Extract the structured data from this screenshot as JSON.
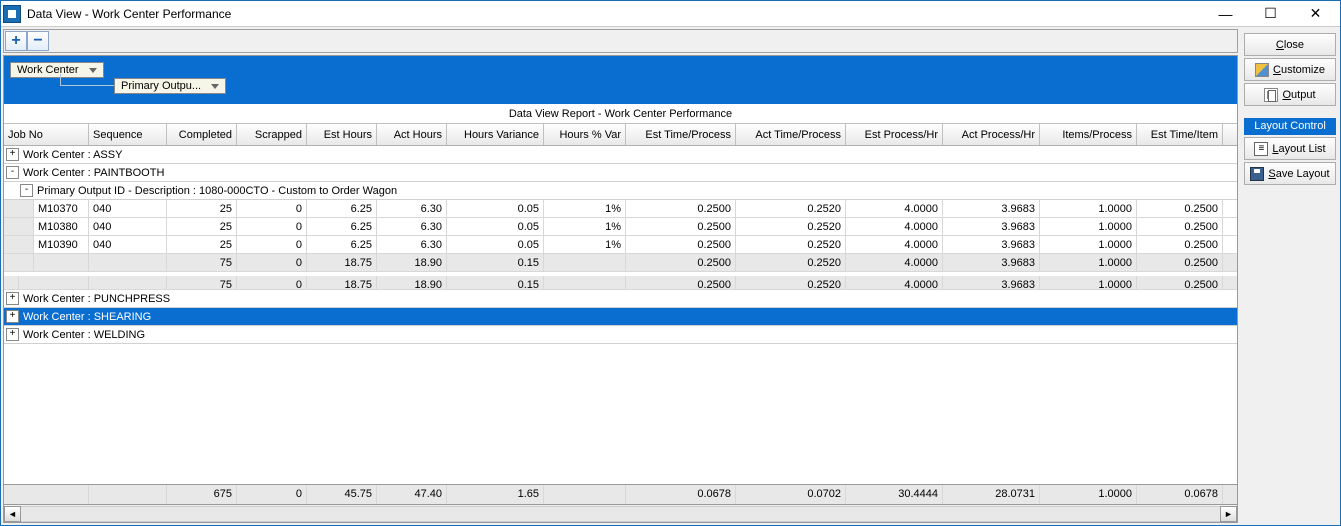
{
  "window": {
    "title": "Data View - Work Center Performance"
  },
  "toolbar": {
    "expand": "+",
    "collapse": "−"
  },
  "group_chips": {
    "g1": "Work Center",
    "g2": "Primary Outpu..."
  },
  "report_title": "Data View Report - Work Center Performance",
  "columns": {
    "job": "Job No",
    "seq": "Sequence",
    "comp": "Completed",
    "scrap": "Scrapped",
    "esth": "Est Hours",
    "acth": "Act Hours",
    "hvar": "Hours Variance",
    "hpvar": "Hours % Var",
    "etp": "Est Time/Process",
    "atp": "Act Time/Process",
    "eph": "Est Process/Hr",
    "aph": "Act Process/Hr",
    "ipp": "Items/Process",
    "eti": "Est Time/Item"
  },
  "groups": {
    "assy": "Work Center : ASSY",
    "paint": "Work Center : PAINTBOOTH",
    "paint_sub": "Primary Output ID - Description : 1080-000CTO - Custom to Order Wagon",
    "punch": "Work Center : PUNCHPRESS",
    "shear": "Work Center : SHEARING",
    "weld": "Work Center : WELDING"
  },
  "rows": [
    {
      "job": "M10370",
      "seq": "040",
      "comp": "25",
      "scrap": "0",
      "esth": "6.25",
      "acth": "6.30",
      "hvar": "0.05",
      "hpvar": "1%",
      "etp": "0.2500",
      "atp": "0.2520",
      "eph": "4.0000",
      "aph": "3.9683",
      "ipp": "1.0000",
      "eti": "0.2500"
    },
    {
      "job": "M10380",
      "seq": "040",
      "comp": "25",
      "scrap": "0",
      "esth": "6.25",
      "acth": "6.30",
      "hvar": "0.05",
      "hpvar": "1%",
      "etp": "0.2500",
      "atp": "0.2520",
      "eph": "4.0000",
      "aph": "3.9683",
      "ipp": "1.0000",
      "eti": "0.2500"
    },
    {
      "job": "M10390",
      "seq": "040",
      "comp": "25",
      "scrap": "0",
      "esth": "6.25",
      "acth": "6.30",
      "hvar": "0.05",
      "hpvar": "1%",
      "etp": "0.2500",
      "atp": "0.2520",
      "eph": "4.0000",
      "aph": "3.9683",
      "ipp": "1.0000",
      "eti": "0.2500"
    }
  ],
  "subtotal1": {
    "comp": "75",
    "scrap": "0",
    "esth": "18.75",
    "acth": "18.90",
    "hvar": "0.15",
    "hpvar": "",
    "etp": "0.2500",
    "atp": "0.2520",
    "eph": "4.0000",
    "aph": "3.9683",
    "ipp": "1.0000",
    "eti": "0.2500"
  },
  "subtotal2": {
    "comp": "75",
    "scrap": "0",
    "esth": "18.75",
    "acth": "18.90",
    "hvar": "0.15",
    "hpvar": "",
    "etp": "0.2500",
    "atp": "0.2520",
    "eph": "4.0000",
    "aph": "3.9683",
    "ipp": "1.0000",
    "eti": "0.2500"
  },
  "grandtotal": {
    "comp": "675",
    "scrap": "0",
    "esth": "45.75",
    "acth": "47.40",
    "hvar": "1.65",
    "hpvar": "",
    "etp": "0.0678",
    "atp": "0.0702",
    "eph": "30.4444",
    "aph": "28.0731",
    "ipp": "1.0000",
    "eti": "0.0678"
  },
  "sidebar": {
    "close": "Close",
    "close_u": "C",
    "customize": "Customize",
    "customize_u": "C",
    "output": "Output",
    "output_u": "O",
    "layout_control": "Layout Control",
    "layout_list": "Layout List",
    "layout_list_u": "L",
    "save_layout": "Save Layout",
    "save_layout_u": "S"
  }
}
